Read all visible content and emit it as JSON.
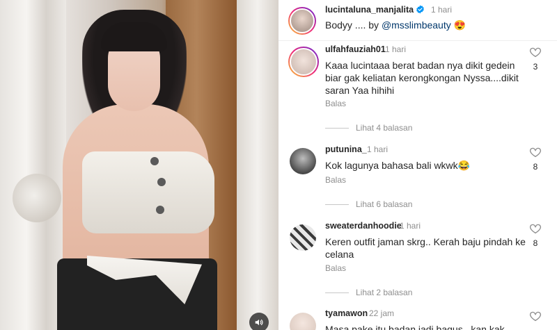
{
  "post": {
    "username": "lucintaluna_manjalita",
    "time": "1 hari",
    "caption_prefix": "Bodyy .... by ",
    "caption_mention": "@msslimbeauty",
    "caption_emoji": "😍"
  },
  "reply_label": "Balas",
  "comments": [
    {
      "username": "ulfahfauziah01",
      "time": "1 hari",
      "text": "Kaaa lucintaaa berat badan nya dikit gedein biar gak keliatan kerongkongan Nyssa....dikit saran Yaa hihihi",
      "likes": "3",
      "view_replies": "Lihat 4 balasan"
    },
    {
      "username": "putunina_",
      "time": "1 hari",
      "text": "Kok lagunya bahasa bali wkwk😂",
      "likes": "8",
      "view_replies": "Lihat 6 balasan"
    },
    {
      "username": "sweaterdanhoodie",
      "time": "1 hari",
      "text": "Keren outfit jaman skrg.. Kerah baju pindah ke celana",
      "likes": "8",
      "view_replies": "Lihat 2 balasan"
    },
    {
      "username": "tyamawon",
      "time": "22 jam",
      "text": "Masa pake itu badan jadi bagus , kan kak",
      "likes": "",
      "view_replies": ""
    }
  ],
  "icons": {
    "verified": "verified-badge-icon",
    "like": "heart-icon",
    "sound": "speaker-icon"
  },
  "colors": {
    "verified": "#0095f6",
    "muted": "#8e8e8e",
    "text": "#262626"
  }
}
